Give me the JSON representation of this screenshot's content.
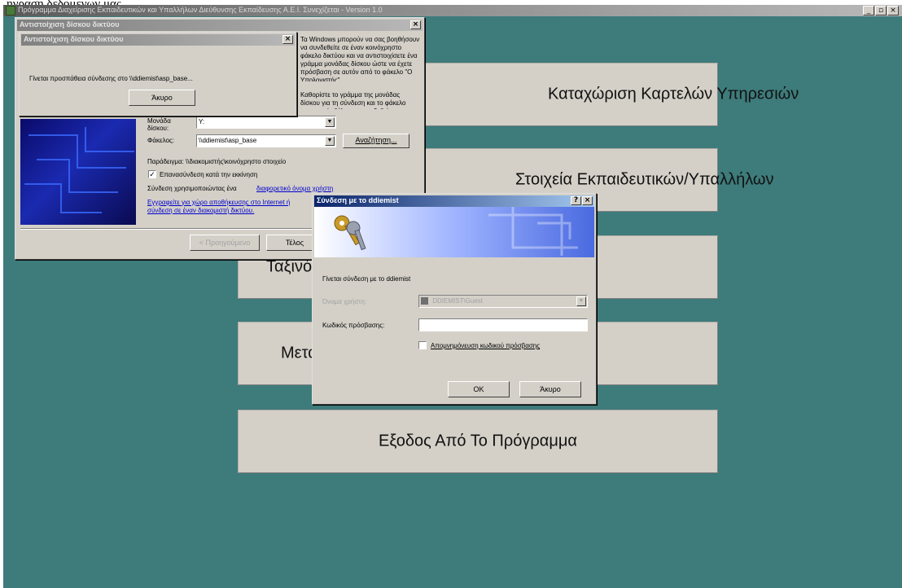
{
  "top_caption": "ηγραση δεδομενων μας",
  "app_window": {
    "title": "Πρόγραμμα Διαχείρισης Εκπαιδευτικών και Υπαλλήλων Διεύθυνσης Εκπαίδευσης Α.Ε.Ι. Συνεχίζεται - Version 1.0",
    "controls": [
      "_",
      "▫",
      "×"
    ]
  },
  "menu_buttons": [
    "Καταχώριση Καρτελών Υπηρεσιών",
    "Στοιχεία Εκπαιδευτικών/Υπαλλήλων",
    "Ταξινόμηση Εκπαιδευτικών/Υπαλλήλων",
    "Μεταφορά Στοιχείων σε Άλλο Έτος",
    "Εξοδος Από Το Πρόγραμμα"
  ],
  "map_drive_dialog": {
    "title": "Αντιστοίχιση δίσκου δικτύου",
    "intro": "Τα Windows μπορούν να σας βοηθήσουν να συνδεθείτε σε έναν κοινόχρηστο φάκελο δικτύου και να αντιστοιχίσετε ένα γράμμα μονάδας δίσκου ώστε να έχετε πρόσβαση σε αυτόν από το φάκελο \"Ο Υπολογιστής\".",
    "prompt": "Καθορίστε το γράμμα της μονάδας δίσκου για τη σύνδεση και το φάκελο στον οποίο θέλετε να συνδεθείτε:",
    "drive_label": "Μονάδα δίσκου:",
    "drive_value": "Y:",
    "folder_label": "Φάκελος:",
    "folder_value": "\\\\ddiemist\\asp_base",
    "browse_label": "Αναζήτηση...",
    "example": "Παράδειγμα: \\\\διακομιστής\\κοινόχρηστο στοιχείο",
    "reconnect_label": "Επανασύνδεση κατά την εκκίνηση",
    "reconnect_checked": "✓",
    "connect_other_text": "Σύνδεση χρησιμοποιώντας ένα",
    "connect_other_link": "διαφορετικό όνομα χρήστη",
    "signup_link": "Εγγραφείτε για χώρο αποθήκευσης στο Internet ή σύνδεση σε έναν διακομιστή δικτύου.",
    "back_label": "< Προηγούμενο",
    "finish_label": "Τέλος"
  },
  "progress_dialog": {
    "title": "Αντιστοίχιση δίσκου δικτύου",
    "message": "Γίνεται προσπάθεια σύνδεσης στο \\\\ddiemist\\asp_base...",
    "cancel_label": "Άκυρο"
  },
  "connect_dialog": {
    "title": "Σύνδεση με το ddiemist",
    "help": "?",
    "message": "Γίνεται σύνδεση με το ddiemist",
    "user_label": "Όνομα χρήστη:",
    "user_value": "DDIEMIST\\Guest",
    "password_label": "Κωδικός πρόσβασης:",
    "password_value": "",
    "remember_label": "Απομνημόνευση κωδικού πρόσβασης",
    "ok_label": "OK",
    "cancel_label": "Άκυρο"
  }
}
